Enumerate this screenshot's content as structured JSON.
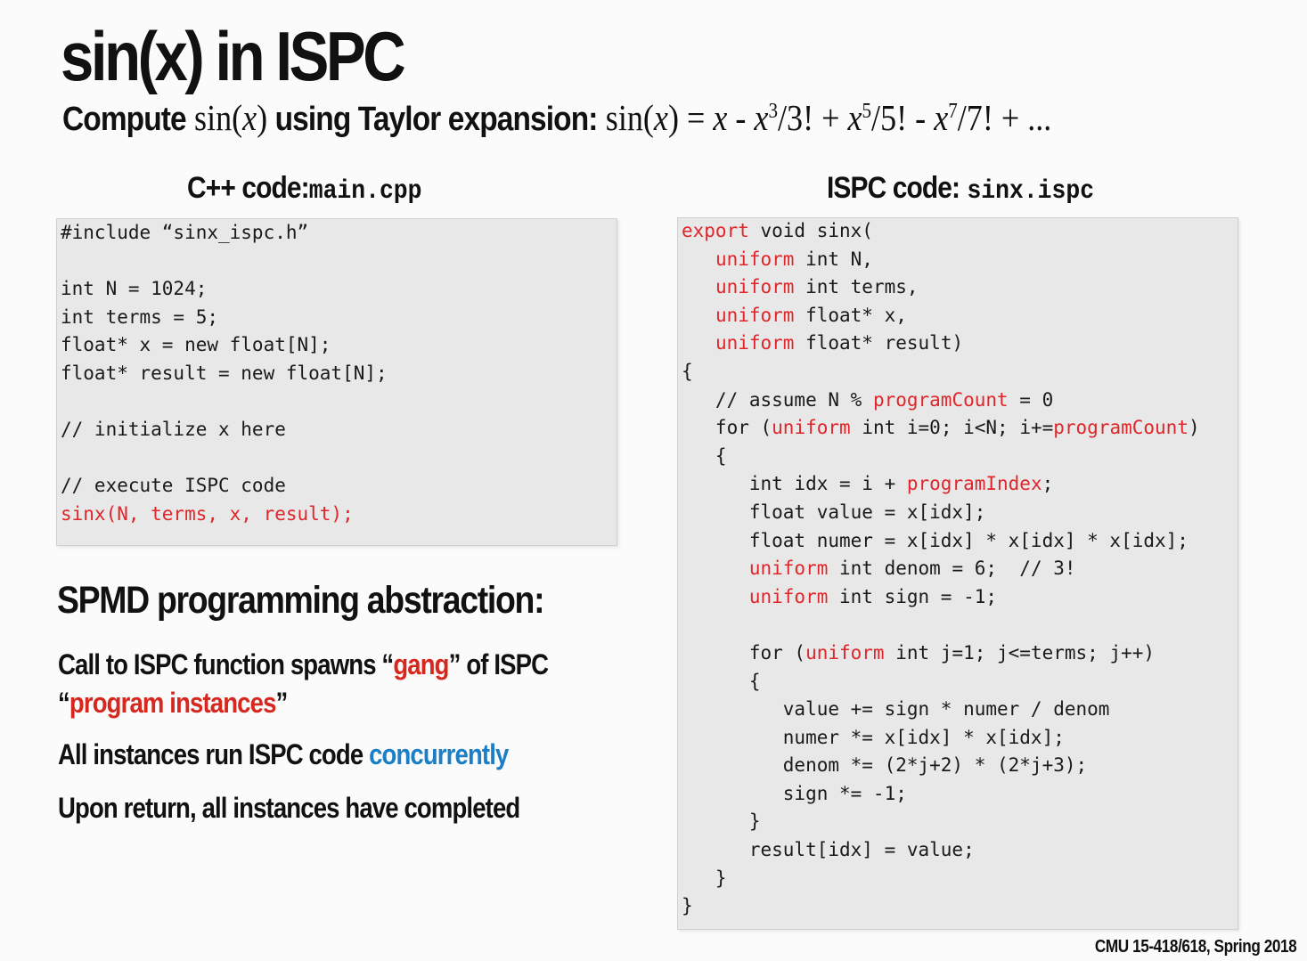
{
  "title": "sin(x) in ISPC",
  "subtitle": {
    "lead": "Compute",
    "fn": "sin(",
    "x": "x",
    "close": ")",
    "mid": " using Taylor expansion:",
    "formula_a": "sin(",
    "formula_x": "x",
    "formula_b": ") = ",
    "t1": "x",
    "t2a": " - ",
    "t2": "x",
    "e3": "3",
    "t2b": "/3! + ",
    "t3": "x",
    "e5": "5",
    "t3b": "/5! - ",
    "t4": "x",
    "e7": "7",
    "t4b": "/7! + ..."
  },
  "left_panel": {
    "heading": "C++ code:",
    "filename": "main.cpp",
    "lines": [
      "#include “sinx_ispc.h”",
      "",
      "int N = 1024;",
      "int terms = 5;",
      "float* x = new float[N];",
      "float* result = new float[N];",
      "",
      "// initialize x here",
      "",
      "// execute ISPC code",
      "sinx(N, terms, x, result);"
    ]
  },
  "right_panel": {
    "heading": "ISPC code:",
    "filename": "sinx.ispc",
    "lines": [
      "export void sinx(",
      "   uniform int N,",
      "   uniform int terms,",
      "   uniform float* x,",
      "   uniform float* result)",
      "{",
      "   // assume N % programCount = 0",
      "   for (uniform int i=0; i<N; i+=programCount)",
      "   {",
      "      int idx = i + programIndex;",
      "      float value = x[idx];",
      "      float numer = x[idx] * x[idx] * x[idx];",
      "      uniform int denom = 6;  // 3!",
      "      uniform int sign = -1;",
      "",
      "      for (uniform int j=1; j<=terms; j++)",
      "      {",
      "         value += sign * numer / denom",
      "         numer *= x[idx] * x[idx];",
      "         denom *= (2*j+2) * (2*j+3);",
      "         sign *= -1;",
      "      }",
      "      result[idx] = value;",
      "   }",
      "}"
    ]
  },
  "section": {
    "heading": "SPMD programming abstraction:",
    "bullet1_a": "Call to ISPC function spawns “",
    "bullet1_gang": "gang",
    "bullet1_b": "” of ISPC",
    "bullet1_c": "“",
    "bullet1_pi": "program instances",
    "bullet1_d": "”",
    "bullet2_a": "All instances run ISPC code ",
    "bullet2_conc": "concurrently",
    "bullet3": "Upon return, all instances have completed"
  },
  "footer": "CMU 15-418/618, Spring 2018",
  "colors": {
    "accent_red": "#d6281e",
    "accent_blue": "#1a7fc6",
    "code_bg": "#e8e8e8"
  }
}
